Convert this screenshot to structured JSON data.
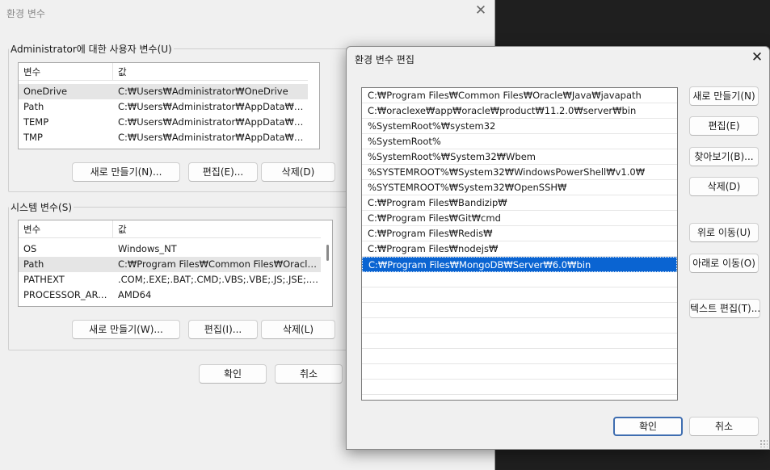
{
  "env_dialog": {
    "title": "환경 변수",
    "user_section": {
      "legend": "Administrator에 대한 사용자 변수(U)",
      "headers": [
        "변수",
        "값"
      ],
      "rows": [
        {
          "name": "OneDrive",
          "value": "C:₩Users₩Administrator₩OneDrive"
        },
        {
          "name": "Path",
          "value": "C:₩Users₩Administrator₩AppData₩Local₩..."
        },
        {
          "name": "TEMP",
          "value": "C:₩Users₩Administrator₩AppData₩Local₩..."
        },
        {
          "name": "TMP",
          "value": "C:₩Users₩Administrator₩AppData₩Local₩..."
        }
      ],
      "new_label": "새로 만들기(N)...",
      "edit_label": "편집(E)...",
      "delete_label": "삭제(D)"
    },
    "system_section": {
      "legend": "시스템 변수(S)",
      "headers": [
        "변수",
        "값"
      ],
      "rows": [
        {
          "name": "OS",
          "value": "Windows_NT"
        },
        {
          "name": "Path",
          "value": "C:₩Program Files₩Common Files₩Oracle₩..."
        },
        {
          "name": "PATHEXT",
          "value": ".COM;.EXE;.BAT;.CMD;.VBS;.VBE;.JS;.JSE;.W..."
        },
        {
          "name": "PROCESSOR_ARC...",
          "value": "AMD64"
        }
      ],
      "new_label": "새로 만들기(W)...",
      "edit_label": "편집(I)...",
      "delete_label": "삭제(L)"
    },
    "ok_label": "확인",
    "cancel_label": "취소"
  },
  "edit_dialog": {
    "title": "환경 변수 편집",
    "paths": [
      "C:₩Program Files₩Common Files₩Oracle₩Java₩javapath",
      "C:₩oraclexe₩app₩oracle₩product₩11.2.0₩server₩bin",
      "%SystemRoot%₩system32",
      "%SystemRoot%",
      "%SystemRoot%₩System32₩Wbem",
      "%SYSTEMROOT%₩System32₩WindowsPowerShell₩v1.0₩",
      "%SYSTEMROOT%₩System32₩OpenSSH₩",
      "C:₩Program Files₩Bandizip₩",
      "C:₩Program Files₩Git₩cmd",
      "C:₩Program Files₩Redis₩",
      "C:₩Program Files₩nodejs₩",
      "C:₩Program Files₩MongoDB₩Server₩6.0₩bin"
    ],
    "selected_index": 11,
    "buttons": {
      "new": "새로 만들기(N)",
      "edit": "편집(E)",
      "browse": "찾아보기(B)...",
      "delete": "삭제(D)",
      "move_up": "위로 이동(U)",
      "move_down": "아래로 이동(O)",
      "text_edit": "텍스트 편집(T)..."
    },
    "ok_label": "확인",
    "cancel_label": "취소"
  },
  "colors": {
    "dialog_bg": "#f0f0f0",
    "selection": "#0a64d2",
    "desktop": "#1f1f1f"
  }
}
